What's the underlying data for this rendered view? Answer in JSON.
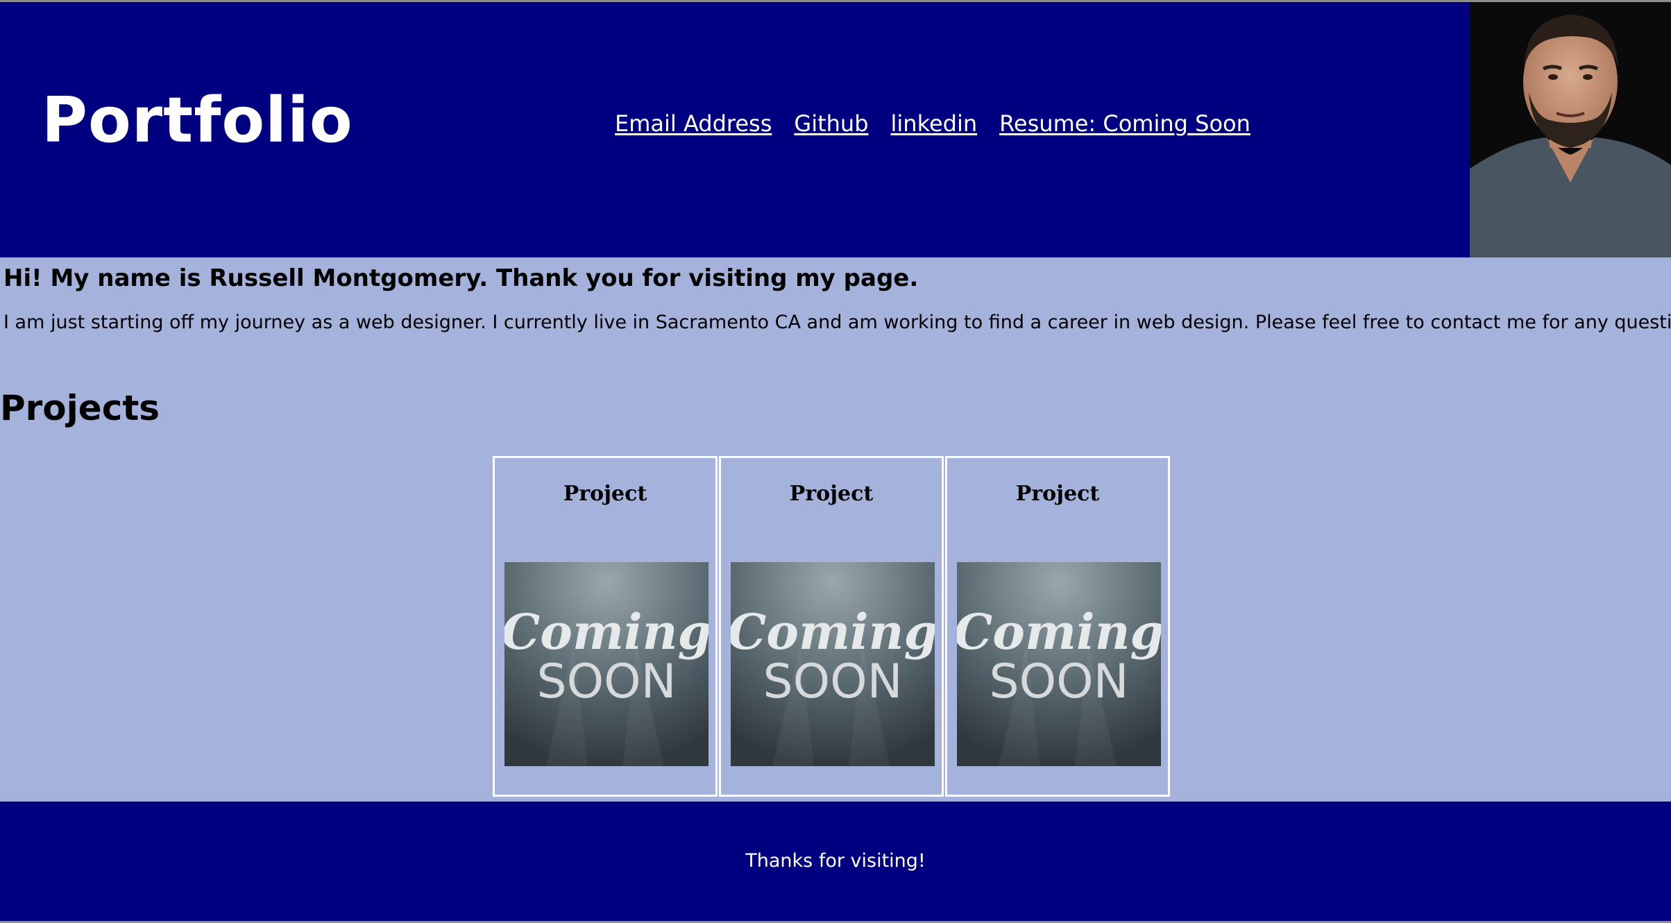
{
  "header": {
    "title": "Portfolio",
    "nav": [
      {
        "label": "Email Address"
      },
      {
        "label": "Github"
      },
      {
        "label": "linkedin"
      },
      {
        "label": "Resume: Coming Soon"
      }
    ]
  },
  "intro": {
    "heading": "Hi! My name is Russell Montgomery. Thank you for visiting my page.",
    "text": "I am just starting off my journey as a web designer. I currently live in Sacramento CA and am working to find a career in web design. Please feel free to contact me for any questions."
  },
  "projects": {
    "heading": "Projects",
    "items": [
      {
        "title": "Project",
        "image_caption_line1": "Coming",
        "image_caption_line2": "SOON"
      },
      {
        "title": "Project",
        "image_caption_line1": "Coming",
        "image_caption_line2": "SOON"
      },
      {
        "title": "Project",
        "image_caption_line1": "Coming",
        "image_caption_line2": "SOON"
      }
    ]
  },
  "footer": {
    "text": "Thanks for visiting!"
  },
  "colors": {
    "header_bg": "#000080",
    "page_bg": "#a5b3dc",
    "link": "#ffffff"
  }
}
